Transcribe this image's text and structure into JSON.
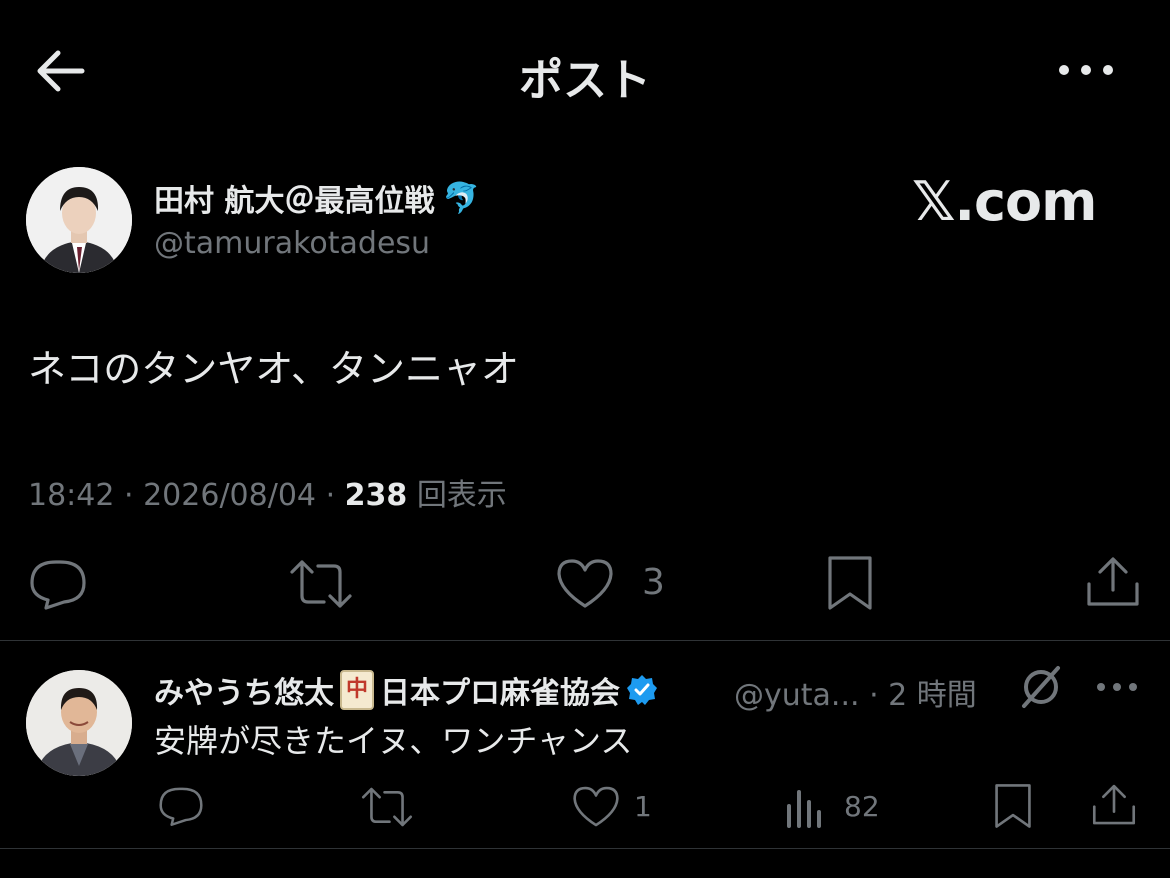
{
  "header": {
    "title": "ポスト",
    "back_icon": "arrow-left-icon",
    "more_icon": "more-horizontal-icon"
  },
  "post": {
    "author_name": "田村 航大＠最高位戦",
    "author_emoji": "🐬",
    "author_handle": "@tamurakotadesu",
    "watermark": "𝕏.com",
    "text": "ネコのタンヤオ、タンニャオ",
    "time": "18:42",
    "date": "2026/08/04",
    "views_count": "238",
    "views_label": "回表示",
    "like_count": "3"
  },
  "reply": {
    "author_name_a": "みやうち悠太",
    "tile_char": "中",
    "author_name_b": "日本プロ麻雀協会",
    "verified_color": "#1d9bf0",
    "handle": "@yuta...",
    "dot": "·",
    "time": "2 時間",
    "text": "安牌が尽きたイヌ、ワンチャンス",
    "like_count": "1",
    "view_count": "82"
  },
  "colors": {
    "background": "#000000",
    "text": "#e7e9ea",
    "muted": "#71767b",
    "divider": "#2f3336",
    "verified": "#1d9bf0"
  }
}
